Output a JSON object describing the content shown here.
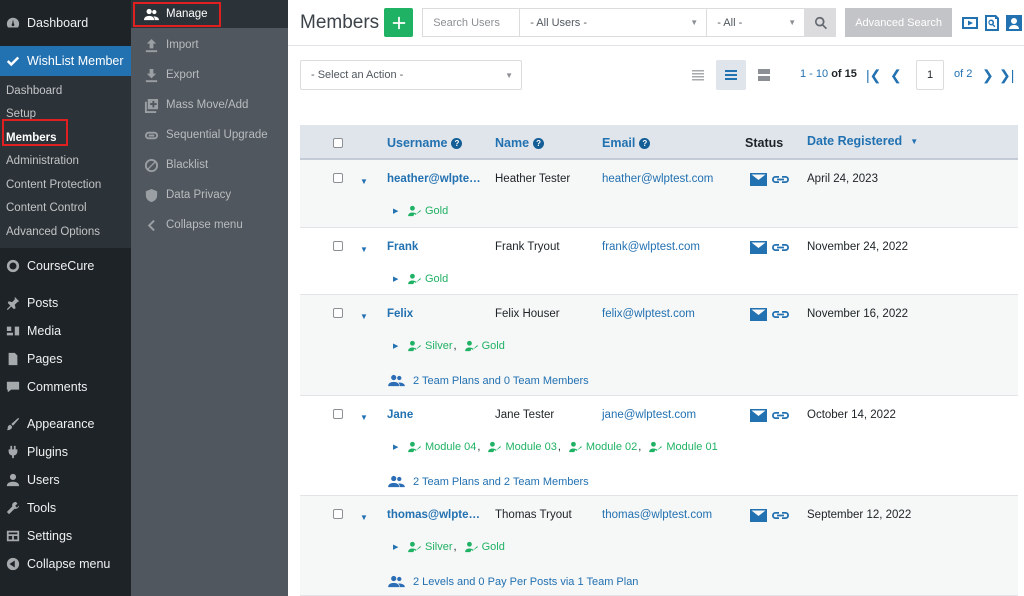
{
  "wp_sidebar": {
    "items_top": [
      {
        "label": "Dashboard",
        "icon": "dashboard-icon"
      },
      {
        "label": "WishList Member",
        "icon": "check-icon"
      }
    ],
    "submenu": [
      "Dashboard",
      "Setup",
      "Members",
      "Administration",
      "Content Protection",
      "Content Control",
      "Advanced Options"
    ],
    "items_bottom": [
      {
        "label": "CourseCure",
        "icon": "coursecure-icon"
      },
      {
        "label": "Posts",
        "icon": "pin-icon"
      },
      {
        "label": "Media",
        "icon": "media-icon"
      },
      {
        "label": "Pages",
        "icon": "pages-icon"
      },
      {
        "label": "Comments",
        "icon": "comment-icon"
      },
      {
        "label": "Appearance",
        "icon": "brush-icon"
      },
      {
        "label": "Plugins",
        "icon": "plug-icon"
      },
      {
        "label": "Users",
        "icon": "user-icon"
      },
      {
        "label": "Tools",
        "icon": "wrench-icon"
      },
      {
        "label": "Settings",
        "icon": "settings-icon"
      },
      {
        "label": "Collapse menu",
        "icon": "collapse-icon"
      }
    ]
  },
  "wl_sidebar": {
    "items": [
      {
        "label": "Manage",
        "icon": "users-icon"
      },
      {
        "label": "Import",
        "icon": "upload-icon"
      },
      {
        "label": "Export",
        "icon": "download-icon"
      },
      {
        "label": "Mass Move/Add",
        "icon": "mass-add-icon"
      },
      {
        "label": "Sequential Upgrade",
        "icon": "link-icon"
      },
      {
        "label": "Blacklist",
        "icon": "block-icon"
      },
      {
        "label": "Data Privacy",
        "icon": "shield-icon"
      },
      {
        "label": "Collapse menu",
        "icon": "chevron-left-icon"
      }
    ]
  },
  "header": {
    "title": "Members",
    "search_placeholder": "Search Users",
    "filter_users": "- All Users -",
    "filter_all": "- All -",
    "advanced_search": "Advanced Search"
  },
  "actions": {
    "select_action": "- Select an Action -"
  },
  "pagination": {
    "range": "1 - 10",
    "of_label": "of",
    "total": "15",
    "page": "1",
    "of_pages": "of 2"
  },
  "table": {
    "headers": {
      "username": "Username",
      "name": "Name",
      "email": "Email",
      "status": "Status",
      "date": "Date Registered"
    },
    "rows": [
      {
        "username": "heather@wlpte…",
        "name": "Heather Tester",
        "email": "heather@wlptest.com",
        "date": "April 24, 2023",
        "levels": [
          "Gold"
        ],
        "team": ""
      },
      {
        "username": "Frank",
        "name": "Frank Tryout",
        "email": "frank@wlptest.com",
        "date": "November 24, 2022",
        "levels": [
          "Gold"
        ],
        "team": ""
      },
      {
        "username": "Felix",
        "name": "Felix Houser",
        "email": "felix@wlptest.com",
        "date": "November 16, 2022",
        "levels": [
          "Silver",
          "Gold"
        ],
        "team": "2 Team Plans and 0 Team Members"
      },
      {
        "username": "Jane",
        "name": "Jane Tester",
        "email": "jane@wlptest.com",
        "date": "October 14, 2022",
        "levels": [
          "Module 04",
          "Module 03",
          "Module 02",
          "Module 01"
        ],
        "team": "2 Team Plans and 2 Team Members"
      },
      {
        "username": "thomas@wlpte…",
        "name": "Thomas Tryout",
        "email": "thomas@wlptest.com",
        "date": "September 12, 2022",
        "levels": [
          "Silver",
          "Gold"
        ],
        "team": "2 Levels and 0 Pay Per Posts via 1 Team Plan"
      }
    ]
  },
  "colors": {
    "accent": "#2271b1",
    "green": "#20b264",
    "wp_sidebar": "#1d2327",
    "wl_sidebar": "#50575e",
    "highlight": "#e02020"
  }
}
